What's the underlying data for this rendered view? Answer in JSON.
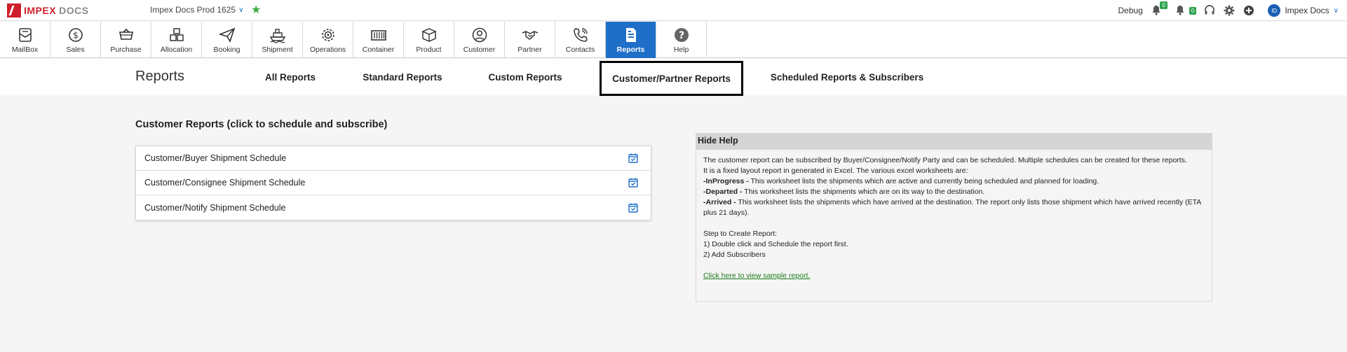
{
  "brand": {
    "part1": "IMPEX",
    "part2": "DOCS"
  },
  "environment": {
    "label": "Impex Docs Prod 1625"
  },
  "topbar_right": {
    "debug_label": "Debug",
    "notif_badge_1": "0",
    "notif_badge_2": "0",
    "user_initials": "ID",
    "user_name": "Impex Docs"
  },
  "modules": [
    {
      "label": "MailBox",
      "icon": "mailbox-icon"
    },
    {
      "label": "Sales",
      "icon": "dollar-icon"
    },
    {
      "label": "Purchase",
      "icon": "cart-icon"
    },
    {
      "label": "Allocation",
      "icon": "boxes-icon"
    },
    {
      "label": "Booking",
      "icon": "paper-plane-icon"
    },
    {
      "label": "Shipment",
      "icon": "ship-icon"
    },
    {
      "label": "Operations",
      "icon": "gear-target-icon"
    },
    {
      "label": "Container",
      "icon": "container-icon"
    },
    {
      "label": "Product",
      "icon": "product-box-icon"
    },
    {
      "label": "Customer",
      "icon": "customer-icon"
    },
    {
      "label": "Partner",
      "icon": "handshake-icon"
    },
    {
      "label": "Contacts",
      "icon": "phone-icon"
    },
    {
      "label": "Reports",
      "icon": "report-icon"
    },
    {
      "label": "Help",
      "icon": "help-icon"
    }
  ],
  "page": {
    "title": "Reports"
  },
  "tabs": [
    {
      "label": "All Reports"
    },
    {
      "label": "Standard Reports"
    },
    {
      "label": "Custom Reports"
    },
    {
      "label": "Customer/Partner Reports"
    },
    {
      "label": "Scheduled Reports & Subscribers"
    }
  ],
  "customer_reports": {
    "heading": "Customer Reports (click to schedule and subscribe)",
    "items": [
      {
        "label": "Customer/Buyer Shipment Schedule"
      },
      {
        "label": "Customer/Consignee Shipment Schedule"
      },
      {
        "label": "Customer/Notify Shipment Schedule"
      }
    ]
  },
  "help": {
    "toggle_label": "Hide Help",
    "intro": "The customer report can be subscribed by Buyer/Consignee/Notify Party and can be scheduled. Multiple schedules can be created for these reports.",
    "layout_note": "It is a fixed layout report in generated in Excel. The various excel worksheets are:",
    "sheet1_name": "-InProgress -",
    "sheet1_desc": " This worksheet lists the shipments which are active and currently being scheduled and planned for loading.",
    "sheet2_name": "-Departed -",
    "sheet2_desc": " This worksheet lists the shipments which are on its way to the destination.",
    "sheet3_name": "-Arrived -",
    "sheet3_desc": " This worksheet lists the shipments which have arrived at the destination. The report only lists those shipment which have arrived recently (ETA plus 21 days).",
    "steps_title": "Step to Create Report:",
    "step1": "1) Double click and Schedule the report first.",
    "step2": "2) Add Subscribers",
    "sample_link": "Click here to view sample report."
  },
  "colors": {
    "brand_red": "#d0202e",
    "active_blue": "#1f6fc9",
    "link_green": "#1a7a1a"
  }
}
